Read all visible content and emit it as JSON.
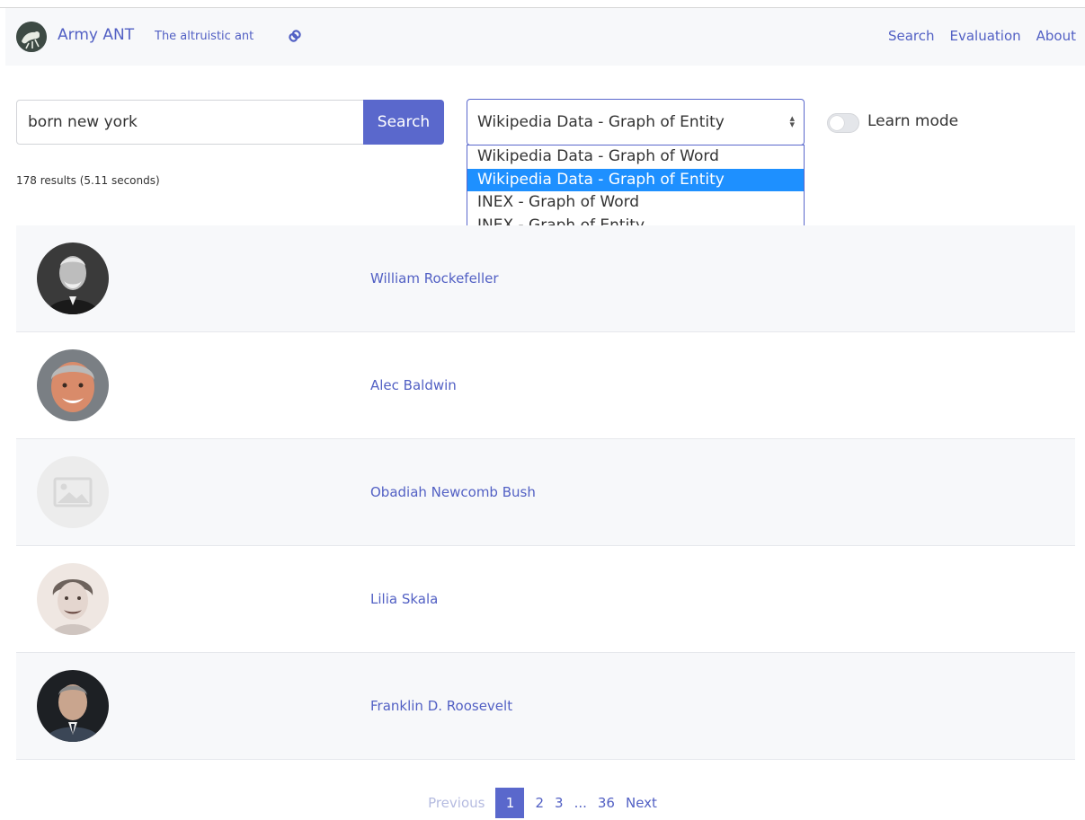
{
  "navbar": {
    "brand_name": "Army ANT",
    "brand_tagline": "The altruistic ant",
    "links": [
      "Search",
      "Evaluation",
      "About"
    ]
  },
  "search": {
    "query": "born new york",
    "button_label": "Search"
  },
  "engine_select": {
    "selected": "Wikipedia Data - Graph of Entity",
    "options": [
      "Wikipedia Data - Graph of Word",
      "Wikipedia Data - Graph of Entity",
      "INEX - Graph of Word",
      "INEX - Graph of Entity"
    ]
  },
  "learn_mode": {
    "label": "Learn mode",
    "enabled": false
  },
  "results_info": "178 results (5.11 seconds)",
  "results": [
    {
      "name": "William Rockefeller"
    },
    {
      "name": "Alec Baldwin"
    },
    {
      "name": "Obadiah Newcomb Bush"
    },
    {
      "name": "Lilia Skala"
    },
    {
      "name": "Franklin D. Roosevelt"
    }
  ],
  "pagination": {
    "previous": "Previous",
    "pages": [
      "1",
      "2",
      "3",
      "...",
      "36"
    ],
    "active": "1",
    "next": "Next"
  },
  "colors": {
    "accent": "#5a68cc",
    "link": "#5260c4",
    "selected_option": "#1e90ff"
  }
}
